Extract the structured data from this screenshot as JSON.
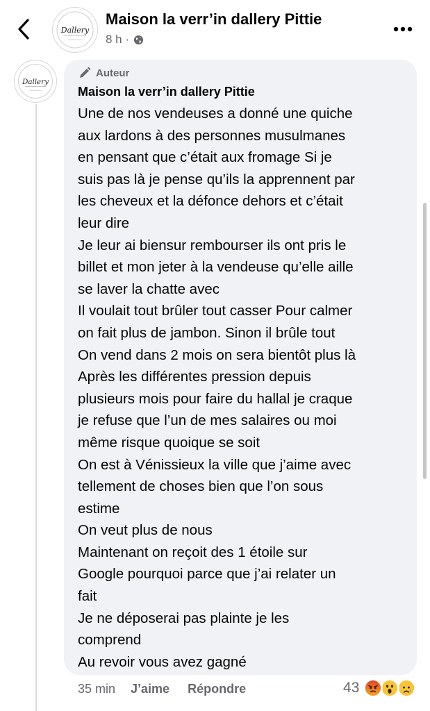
{
  "header": {
    "page_name": "Maison la verr’in dallery Pittie",
    "post_time": "8 h ·",
    "avatar_logo_text": "Dallery"
  },
  "comment": {
    "badge_label": "Auteur",
    "author": "Maison la verr’in dallery Pittie",
    "lines": [
      "Une de nos vendeuses a donné une quiche",
      "aux lardons à des personnes musulmanes",
      "en pensant que c’était aux fromage Si je",
      "suis pas là je pense qu’ils la apprennent par",
      "les cheveux et la défonce dehors et c’était",
      "leur dire",
      "Je leur ai biensur rembourser ils ont pris le",
      "billet et mon jeter à la vendeuse qu’elle aille",
      "se laver la chatte avec",
      "Il voulait tout brûler tout casser Pour calmer",
      "on fait plus de jambon. Sinon il brûle tout",
      "On vend dans 2 mois on sera bientôt plus là",
      "Après les différentes pression depuis",
      "plusieurs mois pour faire du hallal je craque",
      "je refuse que l’un de mes salaires ou moi",
      "même risque quoique se soit",
      "On est à Vénissieux la ville que j’aime avec",
      "tellement de choses  bien que l’on sous",
      "estime",
      "On veut plus de nous",
      "Maintenant on reçoit des 1 étoile sur",
      "Google pourquoi parce que j’ai relater un",
      "fait",
      "Je ne déposerai pas plainte je les",
      "comprend",
      "Au revoir vous avez gagné"
    ],
    "time": "35 min",
    "like_label": "J’aime",
    "reply_label": "Répondre",
    "reaction_count": "43",
    "reaction_icons": [
      "angry-emoji",
      "wow-emoji",
      "sad-emoji"
    ]
  },
  "colors": {
    "bubble": "#f0f2f5",
    "secondary_text": "#65676b",
    "angry": "#e9710f",
    "wow": "#f7b125"
  }
}
